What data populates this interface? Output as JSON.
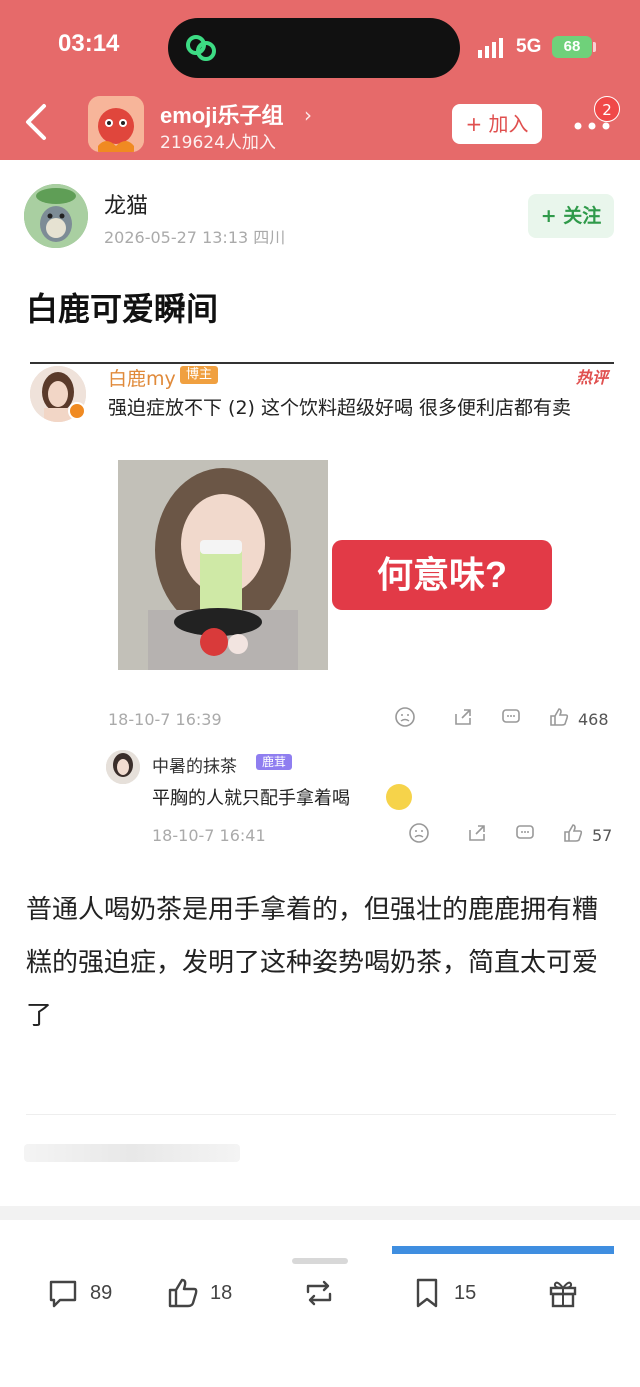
{
  "status_bar": {
    "time": "03:14",
    "network": "5G",
    "battery": "68"
  },
  "group": {
    "name": "emoji乐子组",
    "chevron": "›",
    "member_count": "219624人加入",
    "join_label": "+ 加入",
    "notification_count": "2"
  },
  "post": {
    "author": "龙猫",
    "meta": "2026-05-27 13:13  四川",
    "follow_label": "+ 关注",
    "title": "白鹿可爱瞬间",
    "body": "普通人喝奶茶是用手拿着的，但强壮的鹿鹿拥有糟糕的强迫症，发明了这种姿势喝奶茶，简直太可爱了"
  },
  "embed": {
    "user": "白鹿my",
    "badge": "博主",
    "hot_label": "热评",
    "text": "强迫症放不下 (2) 这个饮料超级好喝 很多便利店都有卖",
    "sticker_text": "何意味?",
    "date": "18-10-7 16:39",
    "likes": "468",
    "reply": {
      "user": "中暑的抹茶",
      "badge": "鹿茸",
      "text": "平胸的人就只配手拿着喝",
      "date": "18-10-7 16:41",
      "likes": "57"
    }
  },
  "bottom_bar": {
    "comments": "89",
    "likes": "18",
    "bookmarks": "15"
  },
  "colors": {
    "header": "#e66a6a",
    "follow_green": "#2f9a4a",
    "accent_red": "#e23a47"
  }
}
